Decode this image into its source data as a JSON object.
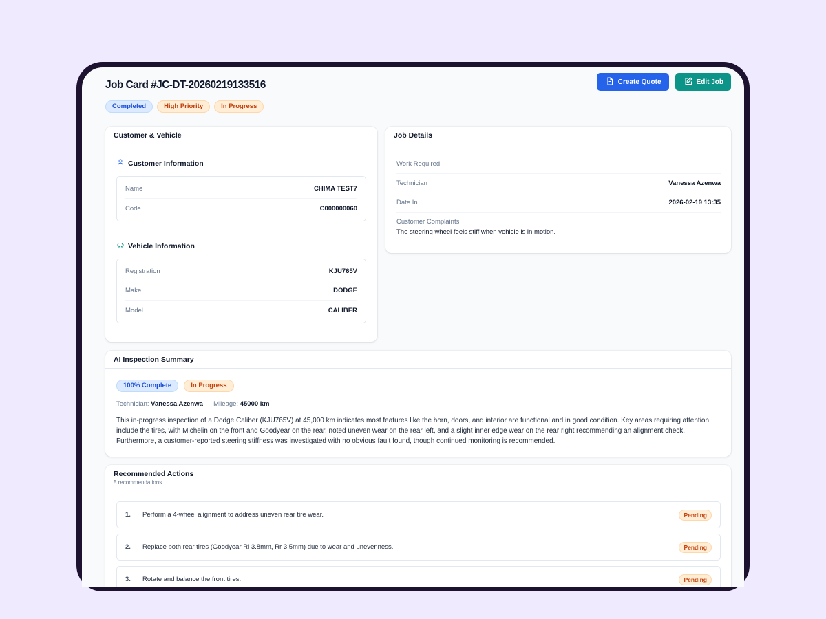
{
  "job": {
    "title": "Job Card #JC-DT-20260219133516",
    "badges": [
      "Completed",
      "High Priority",
      "In Progress"
    ]
  },
  "actions": {
    "create_quote": "Create Quote",
    "edit_job": "Edit Job"
  },
  "customer_vehicle": {
    "header": "Customer & Vehicle",
    "customer_heading": "Customer Information",
    "customer": [
      {
        "label": "Name",
        "value": "CHIMA TEST7"
      },
      {
        "label": "Code",
        "value": "C000000060"
      }
    ],
    "vehicle_heading": "Vehicle Information",
    "vehicle": [
      {
        "label": "Registration",
        "value": "KJU765V"
      },
      {
        "label": "Make",
        "value": "DODGE"
      },
      {
        "label": "Model",
        "value": "CALIBER"
      }
    ]
  },
  "job_details": {
    "header": "Job Details",
    "rows": [
      {
        "label": "Work Required",
        "value": "—"
      },
      {
        "label": "Technician",
        "value": "Vanessa Azenwa"
      },
      {
        "label": "Date In",
        "value": "2026-02-19 13:35"
      }
    ],
    "complaints_label": "Customer Complaints",
    "complaints_text": "The steering wheel feels stiff when vehicle is in motion."
  },
  "ai_summary": {
    "header": "AI Inspection Summary",
    "complete_badge": "100% Complete",
    "status_badge": "In Progress",
    "technician_label": "Technician:",
    "technician": "Vanessa Azenwa",
    "mileage_label": "Mileage:",
    "mileage": "45000 km",
    "summary": "This in-progress inspection of a Dodge Caliber (KJU765V) at 45,000 km indicates most features like the horn, doors, and interior are functional and in good condition. Key areas requiring attention include the tires, with Michelin on the front and Goodyear on the rear, noted uneven wear on the rear left, and a slight inner edge wear on the rear right recommending an alignment check. Furthermore, a customer-reported steering stiffness was investigated with no obvious fault found, though continued monitoring is recommended."
  },
  "recommendations": {
    "header": "Recommended Actions",
    "count_text": "5 recommendations",
    "items": [
      {
        "num": "1.",
        "text": "Perform a 4-wheel alignment to address uneven rear tire wear.",
        "status": "Pending"
      },
      {
        "num": "2.",
        "text": "Replace both rear tires (Goodyear Rl 3.8mm, Rr 3.5mm) due to wear and unevenness.",
        "status": "Pending"
      },
      {
        "num": "3.",
        "text": "Rotate and balance the front tires.",
        "status": "Pending"
      }
    ]
  }
}
